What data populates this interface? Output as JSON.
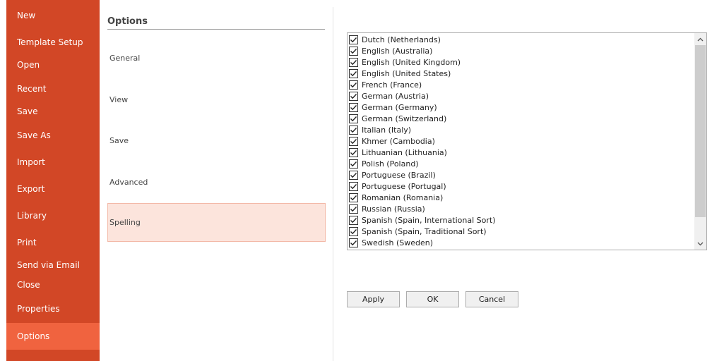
{
  "sidebar": {
    "items": [
      {
        "label": "New"
      },
      {
        "label": "Template Setup"
      },
      {
        "label": "Open"
      },
      {
        "label": "Recent"
      },
      {
        "label": "Save"
      },
      {
        "label": "Save As"
      },
      {
        "label": "Import"
      },
      {
        "label": "Export"
      },
      {
        "label": "Library"
      },
      {
        "label": "Print"
      },
      {
        "label": "Send via Email"
      },
      {
        "label": "Close"
      },
      {
        "label": "Properties"
      },
      {
        "label": "Options"
      }
    ],
    "active": "Options"
  },
  "options": {
    "heading": "Options",
    "categories": [
      {
        "label": "General"
      },
      {
        "label": "View"
      },
      {
        "label": "Save"
      },
      {
        "label": "Advanced"
      },
      {
        "label": "Spelling"
      }
    ],
    "selected": "Spelling"
  },
  "languages": [
    {
      "label": "Dutch (Netherlands)",
      "checked": true
    },
    {
      "label": "English (Australia)",
      "checked": true
    },
    {
      "label": "English (United Kingdom)",
      "checked": true
    },
    {
      "label": "English (United States)",
      "checked": true
    },
    {
      "label": "French (France)",
      "checked": true
    },
    {
      "label": "German (Austria)",
      "checked": true
    },
    {
      "label": "German (Germany)",
      "checked": true
    },
    {
      "label": "German (Switzerland)",
      "checked": true
    },
    {
      "label": "Italian (Italy)",
      "checked": true
    },
    {
      "label": "Khmer (Cambodia)",
      "checked": true
    },
    {
      "label": "Lithuanian (Lithuania)",
      "checked": true
    },
    {
      "label": "Polish (Poland)",
      "checked": true
    },
    {
      "label": "Portuguese (Brazil)",
      "checked": true
    },
    {
      "label": "Portuguese (Portugal)",
      "checked": true
    },
    {
      "label": "Romanian (Romania)",
      "checked": true
    },
    {
      "label": "Russian (Russia)",
      "checked": true
    },
    {
      "label": "Spanish (Spain, International Sort)",
      "checked": true
    },
    {
      "label": "Spanish (Spain, Traditional Sort)",
      "checked": true
    },
    {
      "label": "Swedish (Sweden)",
      "checked": true
    }
  ],
  "buttons": {
    "apply": "Apply",
    "ok": "OK",
    "cancel": "Cancel"
  },
  "icons": {
    "checkbox": "checkmark-icon",
    "scroll_up": "chevron-up-icon",
    "scroll_down": "chevron-down-icon"
  },
  "colors": {
    "sidebar_bg": "#d24726",
    "sidebar_active": "#f0633f",
    "category_selected": "#fce4dc"
  }
}
